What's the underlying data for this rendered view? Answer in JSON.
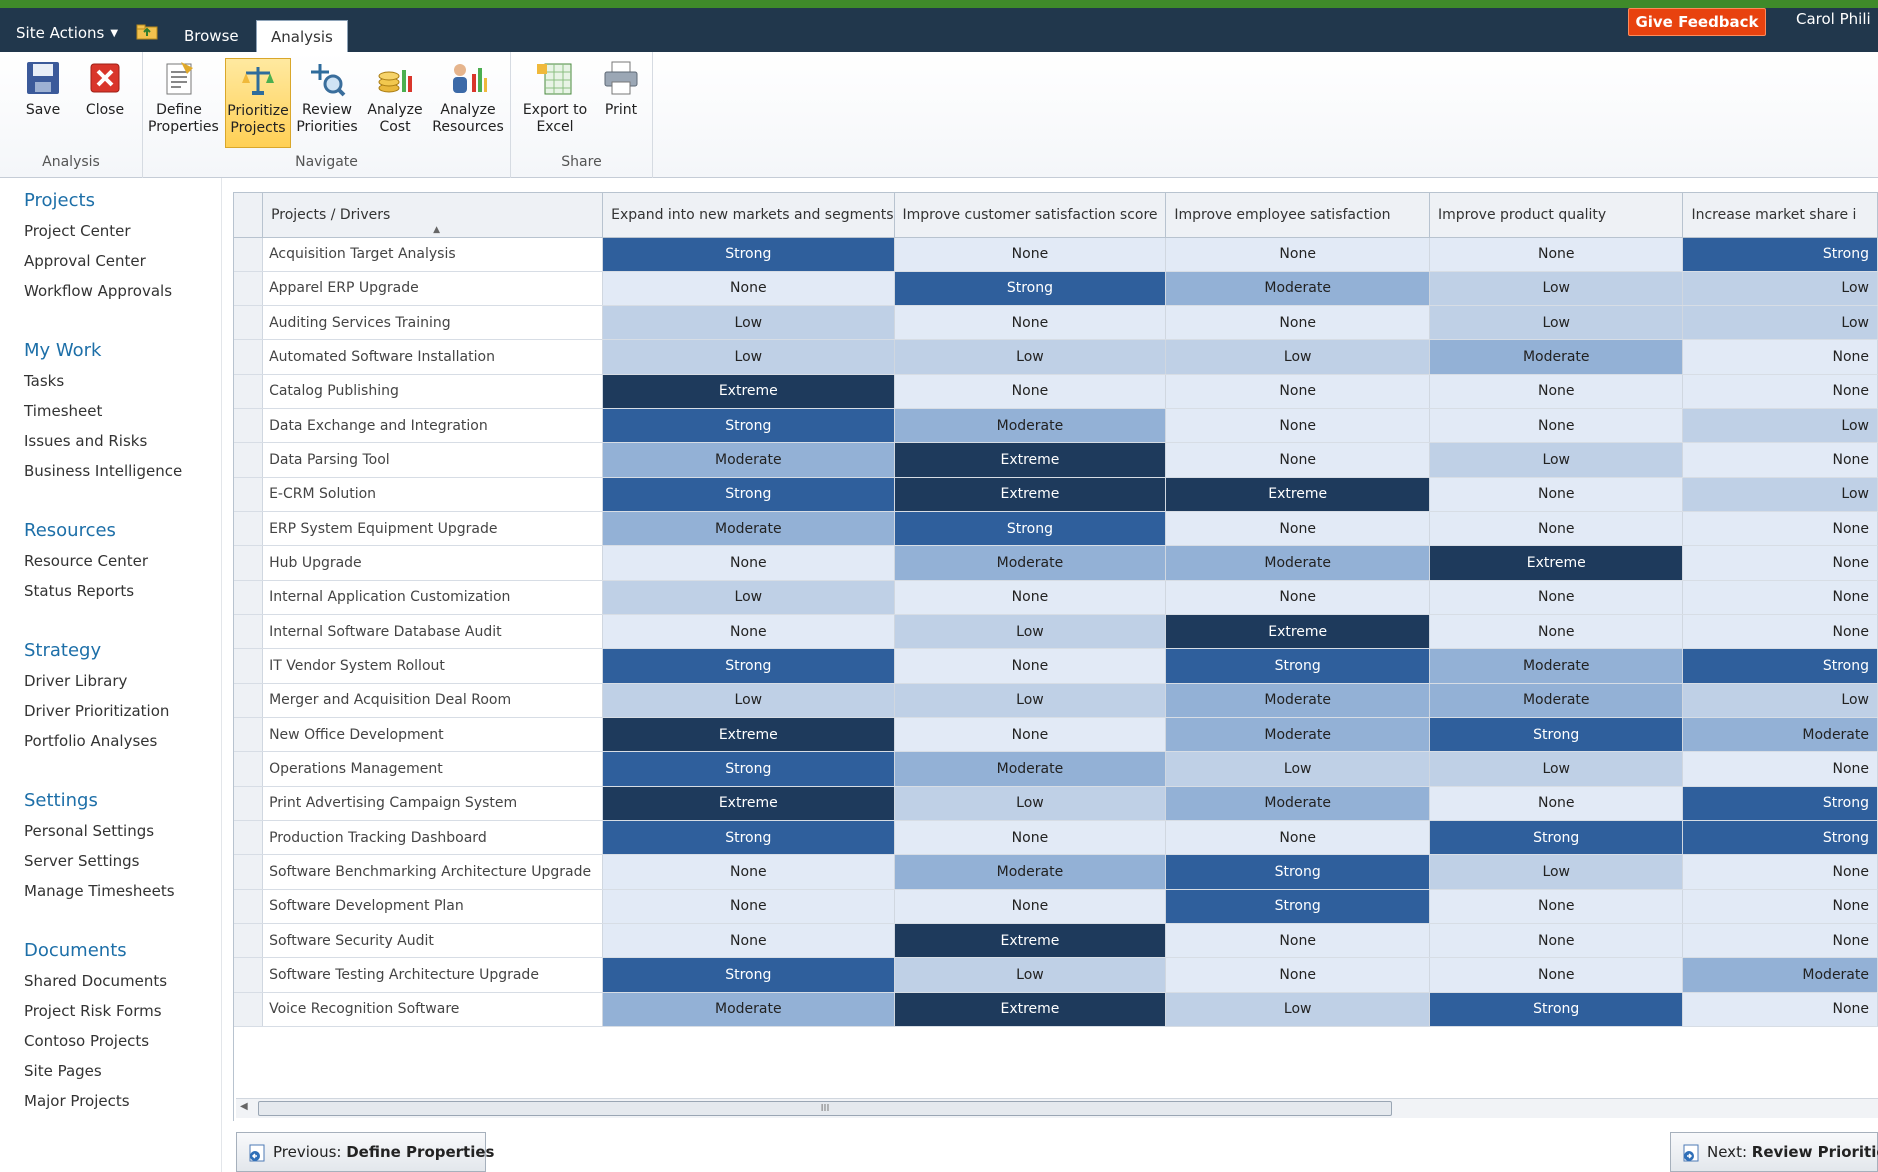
{
  "topbar": {
    "site_actions": "Site Actions",
    "tabs": [
      {
        "label": "Browse"
      },
      {
        "label": "Analysis"
      }
    ],
    "feedback": "Give Feedback",
    "user": "Carol Phili"
  },
  "ribbon": {
    "groups": {
      "analysis": "Analysis",
      "navigate": "Navigate",
      "share": "Share"
    },
    "buttons": {
      "save": "Save",
      "close": "Close",
      "define_properties": {
        "line1": "Define",
        "line2": "Properties"
      },
      "prioritize_projects": {
        "line1": "Prioritize",
        "line2": "Projects"
      },
      "review_priorities": {
        "line1": "Review",
        "line2": "Priorities"
      },
      "analyze_cost": {
        "line1": "Analyze",
        "line2": "Cost"
      },
      "analyze_resources": {
        "line1": "Analyze",
        "line2": "Resources"
      },
      "export_excel": {
        "line1": "Export to",
        "line2": "Excel"
      },
      "print": "Print"
    }
  },
  "nav": {
    "projects": {
      "heading": "Projects",
      "items": [
        "Project Center",
        "Approval Center",
        "Workflow Approvals"
      ]
    },
    "mywork": {
      "heading": "My Work",
      "items": [
        "Tasks",
        "Timesheet",
        "Issues and Risks",
        "Business Intelligence"
      ]
    },
    "resources": {
      "heading": "Resources",
      "items": [
        "Resource Center",
        "Status Reports"
      ]
    },
    "strategy": {
      "heading": "Strategy",
      "items": [
        "Driver Library",
        "Driver Prioritization",
        "Portfolio Analyses"
      ]
    },
    "settings": {
      "heading": "Settings",
      "items": [
        "Personal Settings",
        "Server Settings",
        "Manage Timesheets"
      ]
    },
    "documents": {
      "heading": "Documents",
      "items": [
        "Shared Documents",
        "Project Risk Forms",
        "Contoso Projects",
        "Site Pages",
        "Major Projects"
      ]
    }
  },
  "grid": {
    "columns": [
      "Projects / Drivers",
      "Expand into new markets and segments",
      "Improve customer satisfaction score",
      "Improve employee satisfaction",
      "Improve product quality",
      "Increase market share i"
    ],
    "rows": [
      {
        "name": "Acquisition Target Analysis",
        "values": [
          "Strong",
          "None",
          "None",
          "None",
          "Strong"
        ]
      },
      {
        "name": "Apparel ERP Upgrade",
        "values": [
          "None",
          "Strong",
          "Moderate",
          "Low",
          "Low"
        ]
      },
      {
        "name": "Auditing Services Training",
        "values": [
          "Low",
          "None",
          "None",
          "Low",
          "Low"
        ]
      },
      {
        "name": "Automated Software Installation",
        "values": [
          "Low",
          "Low",
          "Low",
          "Moderate",
          "None"
        ]
      },
      {
        "name": "Catalog Publishing",
        "values": [
          "Extreme",
          "None",
          "None",
          "None",
          "None"
        ]
      },
      {
        "name": "Data Exchange and Integration",
        "values": [
          "Strong",
          "Moderate",
          "None",
          "None",
          "Low"
        ]
      },
      {
        "name": "Data Parsing Tool",
        "values": [
          "Moderate",
          "Extreme",
          "None",
          "Low",
          "None"
        ]
      },
      {
        "name": "E-CRM Solution",
        "values": [
          "Strong",
          "Extreme",
          "Extreme",
          "None",
          "Low"
        ]
      },
      {
        "name": "ERP System Equipment Upgrade",
        "values": [
          "Moderate",
          "Strong",
          "None",
          "None",
          "None"
        ]
      },
      {
        "name": "Hub Upgrade",
        "values": [
          "None",
          "Moderate",
          "Moderate",
          "Extreme",
          "None"
        ]
      },
      {
        "name": "Internal Application Customization",
        "values": [
          "Low",
          "None",
          "None",
          "None",
          "None"
        ]
      },
      {
        "name": "Internal Software Database Audit",
        "values": [
          "None",
          "Low",
          "Extreme",
          "None",
          "None"
        ]
      },
      {
        "name": "IT Vendor System Rollout",
        "values": [
          "Strong",
          "None",
          "Strong",
          "Moderate",
          "Strong"
        ]
      },
      {
        "name": "Merger and Acquisition Deal Room",
        "values": [
          "Low",
          "Low",
          "Moderate",
          "Moderate",
          "Low"
        ]
      },
      {
        "name": "New Office Development",
        "values": [
          "Extreme",
          "None",
          "Moderate",
          "Strong",
          "Moderate"
        ]
      },
      {
        "name": "Operations Management",
        "values": [
          "Strong",
          "Moderate",
          "Low",
          "Low",
          "None"
        ]
      },
      {
        "name": "Print Advertising Campaign System",
        "values": [
          "Extreme",
          "Low",
          "Moderate",
          "None",
          "Strong"
        ]
      },
      {
        "name": "Production Tracking Dashboard",
        "values": [
          "Strong",
          "None",
          "None",
          "Strong",
          "Strong"
        ]
      },
      {
        "name": "Software Benchmarking Architecture Upgrade",
        "values": [
          "None",
          "Moderate",
          "Strong",
          "Low",
          "None"
        ]
      },
      {
        "name": "Software Development Plan",
        "values": [
          "None",
          "None",
          "Strong",
          "None",
          "None"
        ]
      },
      {
        "name": "Software Security Audit",
        "values": [
          "None",
          "Extreme",
          "None",
          "None",
          "None"
        ]
      },
      {
        "name": "Software Testing Architecture Upgrade",
        "values": [
          "Strong",
          "Low",
          "None",
          "None",
          "Moderate"
        ]
      },
      {
        "name": "Voice Recognition Software",
        "values": [
          "Moderate",
          "Extreme",
          "Low",
          "Strong",
          "None"
        ]
      }
    ]
  },
  "scrollbar": {
    "grip": "III"
  },
  "footer": {
    "prev_prefix": "Previous:",
    "prev_target": "Define Properties",
    "next_prefix": "Next:",
    "next_target": "Review Prioritie"
  },
  "colors": {
    "none": "#e2eaf6",
    "low": "#bfd0e6",
    "moderate": "#93b1d6",
    "strong": "#2f5f9c",
    "extreme": "#1e3a5c",
    "topbar": "#21374c",
    "feedback": "#e8420f",
    "nav_heading": "#1d6fa8"
  }
}
